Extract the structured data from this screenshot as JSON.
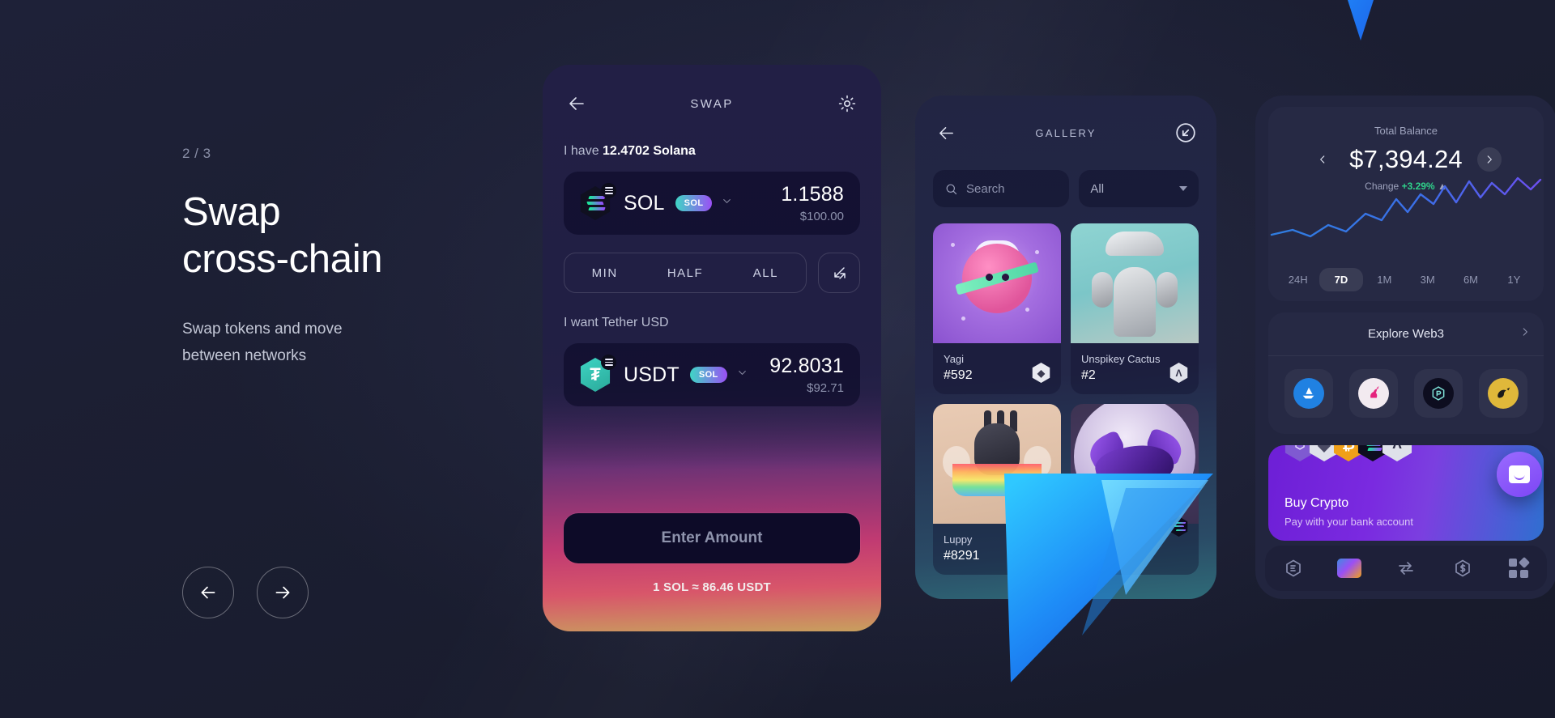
{
  "onboarding": {
    "step": "2 / 3",
    "headline_line1": "Swap",
    "headline_line2": "cross-chain",
    "sub_line1": "Swap tokens and move",
    "sub_line2": "between networks",
    "prev_label": "back-arrow",
    "next_label": "forward-arrow"
  },
  "swap": {
    "title": "SWAP",
    "from_label_prefix": "I have ",
    "from_label_value": "12.4702 Solana",
    "from_token": {
      "symbol": "SOL",
      "network": "SOL",
      "amount": "1.1588",
      "fiat": "$100.00"
    },
    "amount_presets": [
      "MIN",
      "HALF",
      "ALL"
    ],
    "to_label": "I want Tether USD",
    "to_token": {
      "symbol": "USDT",
      "network": "SOL",
      "amount": "92.8031",
      "fiat": "$92.71"
    },
    "cta": "Enter Amount",
    "rate": "1 SOL ≈ 86.46 USDT"
  },
  "gallery": {
    "title": "GALLERY",
    "search_placeholder": "Search",
    "filter_value": "All",
    "items": [
      {
        "name": "Yagi",
        "id": "#592",
        "chain": "eth"
      },
      {
        "name": "Unspikey Cactus",
        "id": "#2",
        "chain": "apt"
      },
      {
        "name": "Luppy",
        "id": "#8291",
        "chain": "sol"
      },
      {
        "name": "",
        "id": "",
        "chain": "sol"
      }
    ]
  },
  "wallet": {
    "balance_label": "Total Balance",
    "balance_value": "$7,394.24",
    "change_label": "Change",
    "change_value": "+3.29%",
    "change_color": "#2fd18a",
    "ranges": [
      "24H",
      "7D",
      "1M",
      "3M",
      "6M",
      "1Y"
    ],
    "active_range": "7D",
    "explore_title": "Explore Web3",
    "apps": [
      "opensea",
      "uniswap",
      "raydium",
      "orca"
    ],
    "buy_title": "Buy Crypto",
    "buy_subtitle": "Pay with your bank account",
    "coins": [
      "polygon",
      "ethereum",
      "bitcoin",
      "solana",
      "aptos"
    ],
    "nav": [
      "web3-icon",
      "wallet-icon",
      "swap-icon",
      "dollar-icon",
      "apps-icon"
    ]
  }
}
